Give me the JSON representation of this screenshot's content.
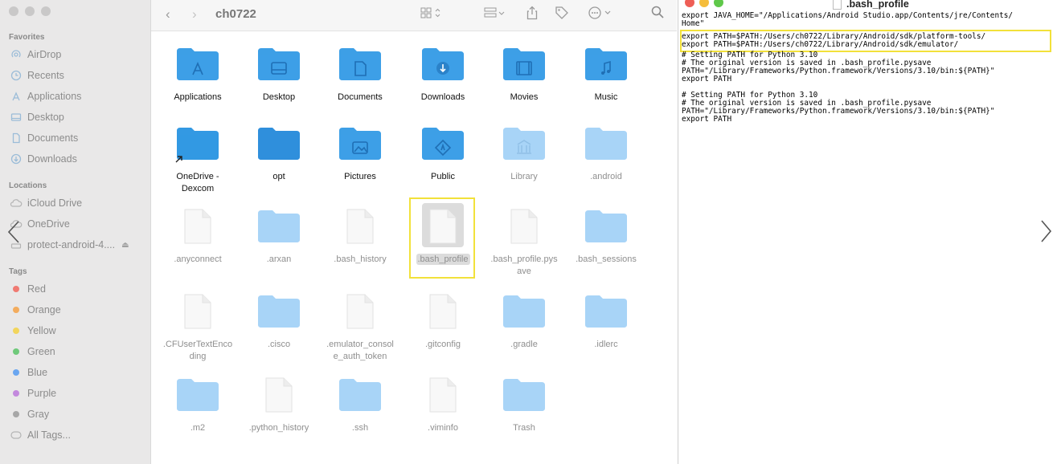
{
  "finder": {
    "path_title": "ch0722",
    "sidebar": {
      "favorites_header": "Favorites",
      "favorites": [
        {
          "label": "AirDrop",
          "icon": "airdrop-icon"
        },
        {
          "label": "Recents",
          "icon": "clock-icon"
        },
        {
          "label": "Applications",
          "icon": "applications-icon"
        },
        {
          "label": "Desktop",
          "icon": "desktop-icon"
        },
        {
          "label": "Documents",
          "icon": "document-icon"
        },
        {
          "label": "Downloads",
          "icon": "download-icon"
        }
      ],
      "locations_header": "Locations",
      "locations": [
        {
          "label": "iCloud Drive",
          "icon": "cloud-icon"
        },
        {
          "label": "OneDrive",
          "icon": "cloud-icon"
        },
        {
          "label": "protect-android-4....",
          "icon": "disk-icon"
        }
      ],
      "tags_header": "Tags",
      "tags": [
        {
          "label": "Red",
          "color": "#f07a72"
        },
        {
          "label": "Orange",
          "color": "#f3ac5e"
        },
        {
          "label": "Yellow",
          "color": "#f2d55c"
        },
        {
          "label": "Green",
          "color": "#6fc97a"
        },
        {
          "label": "Blue",
          "color": "#6aa6f0"
        },
        {
          "label": "Purple",
          "color": "#c389dd"
        },
        {
          "label": "Gray",
          "color": "#a7a7a7"
        }
      ],
      "all_tags": "All Tags..."
    },
    "items": [
      {
        "label": "Applications",
        "kind": "folder-apps"
      },
      {
        "label": "Desktop",
        "kind": "folder-desktop"
      },
      {
        "label": "Documents",
        "kind": "folder-documents"
      },
      {
        "label": "Downloads",
        "kind": "folder-downloads"
      },
      {
        "label": "Movies",
        "kind": "folder-movies"
      },
      {
        "label": "Music",
        "kind": "folder-music"
      },
      {
        "label": "OneDrive -\nDexcom",
        "kind": "folder-alias"
      },
      {
        "label": "opt",
        "kind": "folder-dark"
      },
      {
        "label": "Pictures",
        "kind": "folder-pictures"
      },
      {
        "label": "Public",
        "kind": "folder-public"
      },
      {
        "label": "Library",
        "kind": "folder-library-dim"
      },
      {
        "label": ".android",
        "kind": "folder-dim"
      },
      {
        "label": ".anyconnect",
        "kind": "doc"
      },
      {
        "label": ".arxan",
        "kind": "folder-dim"
      },
      {
        "label": ".bash_history",
        "kind": "doc"
      },
      {
        "label": ".bash_profile",
        "kind": "doc-selected"
      },
      {
        "label": ".bash_profile.pys\nave",
        "kind": "doc"
      },
      {
        "label": ".bash_sessions",
        "kind": "folder-dim"
      },
      {
        "label": ".CFUserTextEnco\nding",
        "kind": "doc"
      },
      {
        "label": ".cisco",
        "kind": "folder-dim"
      },
      {
        "label": ".emulator_consol\ne_auth_token",
        "kind": "doc"
      },
      {
        "label": ".gitconfig",
        "kind": "doc"
      },
      {
        "label": ".gradle",
        "kind": "folder-dim"
      },
      {
        "label": ".idlerc",
        "kind": "folder-dim"
      },
      {
        "label": ".m2",
        "kind": "folder-dim"
      },
      {
        "label": ".python_history",
        "kind": "doc"
      },
      {
        "label": ".ssh",
        "kind": "folder-dim"
      },
      {
        "label": ".viminfo",
        "kind": "doc"
      },
      {
        "label": "Trash",
        "kind": "folder-dim"
      }
    ]
  },
  "editor": {
    "title": ".bash_profile",
    "lines_top": "export JAVA_HOME=\"/Applications/Android Studio.app/Contents/jre/Contents/\nHome\"",
    "lines_highlight": "export PATH=$PATH:/Users/ch0722/Library/Android/sdk/platform-tools/\nexport PATH=$PATH:/Users/ch0722/Library/Android/sdk/emulator/",
    "lines_rest": "# Setting PATH for Python 3.10\n# The original version is saved in .bash_profile.pysave\nPATH=\"/Library/Frameworks/Python.framework/Versions/3.10/bin:${PATH}\"\nexport PATH\n\n# Setting PATH for Python 3.10\n# The original version is saved in .bash_profile.pysave\nPATH=\"/Library/Frameworks/Python.framework/Versions/3.10/bin:${PATH}\"\nexport PATH"
  },
  "colors": {
    "folder_blue": "#3d9fe6",
    "folder_dim": "#a8d4f7",
    "highlight_yellow": "#f2e13a"
  }
}
